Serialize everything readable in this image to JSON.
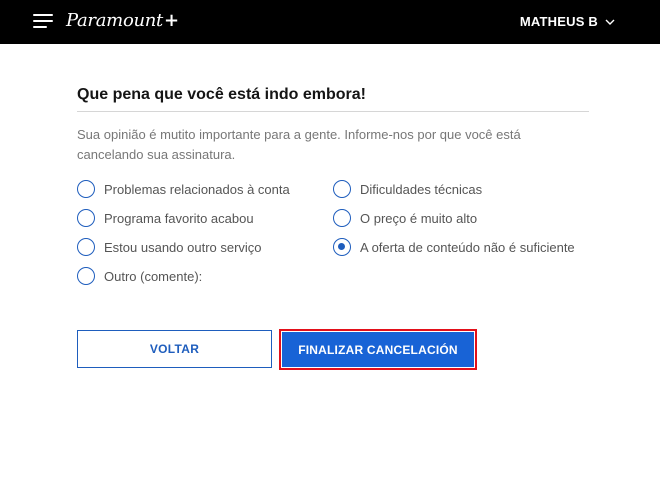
{
  "header": {
    "logo_text": "Paramount",
    "logo_plus": "+",
    "user_name": "MATHEUS B"
  },
  "survey": {
    "title": "Que pena que você está indo embora!",
    "description": "Sua opinião é mutito importante para a gente. Informe-nos por que você está cancelando sua assinatura.",
    "options": [
      {
        "label": "Problemas relacionados à conta",
        "checked": false
      },
      {
        "label": "Programa favorito acabou",
        "checked": false
      },
      {
        "label": "Estou usando outro serviço",
        "checked": false
      },
      {
        "label": "Outro (comente):",
        "checked": false
      },
      {
        "label": "Dificuldades técnicas",
        "checked": false
      },
      {
        "label": "O preço é muito alto",
        "checked": false
      },
      {
        "label": "A oferta de conteúdo não é suficiente",
        "checked": true
      }
    ]
  },
  "actions": {
    "back_label": "VOLTAR",
    "finish_label": "FINALIZAR CANCELACIÓN"
  },
  "colors": {
    "accent": "#1863d6",
    "highlight_border": "#e3101a",
    "header_bg": "#000000"
  }
}
